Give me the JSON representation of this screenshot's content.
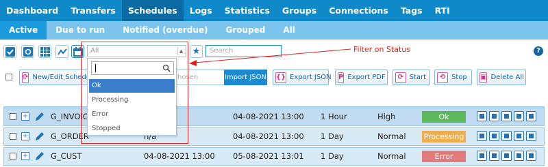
{
  "nav": {
    "items": [
      {
        "label": "Dashboard"
      },
      {
        "label": "Transfers"
      },
      {
        "label": "Schedules",
        "active": true
      },
      {
        "label": "Logs"
      },
      {
        "label": "Statistics"
      },
      {
        "label": "Groups"
      },
      {
        "label": "Connections"
      },
      {
        "label": "Tags"
      },
      {
        "label": "RTI"
      }
    ]
  },
  "subnav": {
    "items": [
      {
        "label": "Active",
        "active": true
      },
      {
        "label": "Due to run"
      },
      {
        "label": "Notified (overdue)"
      },
      {
        "label": "Grouped"
      },
      {
        "label": "All"
      }
    ]
  },
  "toolbar": {
    "status_select_value": "All",
    "search_placeholder": "Search",
    "annotation": "Filter on Status",
    "help": "?"
  },
  "status_dropdown": {
    "search_value": "",
    "options": [
      {
        "label": "Ok",
        "highlighted": true
      },
      {
        "label": "Processing"
      },
      {
        "label": "Error"
      },
      {
        "label": "Stopped"
      }
    ]
  },
  "actions": {
    "new_edit": "New/Edit Schedule",
    "chosen_suffix": "hosen",
    "import_json": "Import JSON",
    "export_json": "Export JSON",
    "export_pdf": "Export PDF",
    "start": "Start",
    "stop": "Stop",
    "delete_all": "Delete All"
  },
  "rows": [
    {
      "name": "G_INVOICE",
      "col2": "",
      "start": "04-08-2021 13:00",
      "interval": "1 Hour",
      "priority": "High",
      "status": "Ok"
    },
    {
      "name": "G_ORDER",
      "col2": "n/a",
      "start": "04-08-2021 13:00",
      "interval": "1 Day",
      "priority": "Normal",
      "status": "Processing"
    },
    {
      "name": "G_CUST",
      "col2": "04-08-2021 13:00",
      "start": "05-08-2021 13:01",
      "interval": "1 Day",
      "priority": "Normal",
      "status": "Error"
    }
  ],
  "colors": {
    "nav_bg": "#0f89c9",
    "subnav_bg": "#7cc4ee",
    "status_ok": "#5cb85c",
    "status_processing": "#f0ad4e",
    "status_error": "#e27b7b",
    "annotation": "#d7261e"
  }
}
